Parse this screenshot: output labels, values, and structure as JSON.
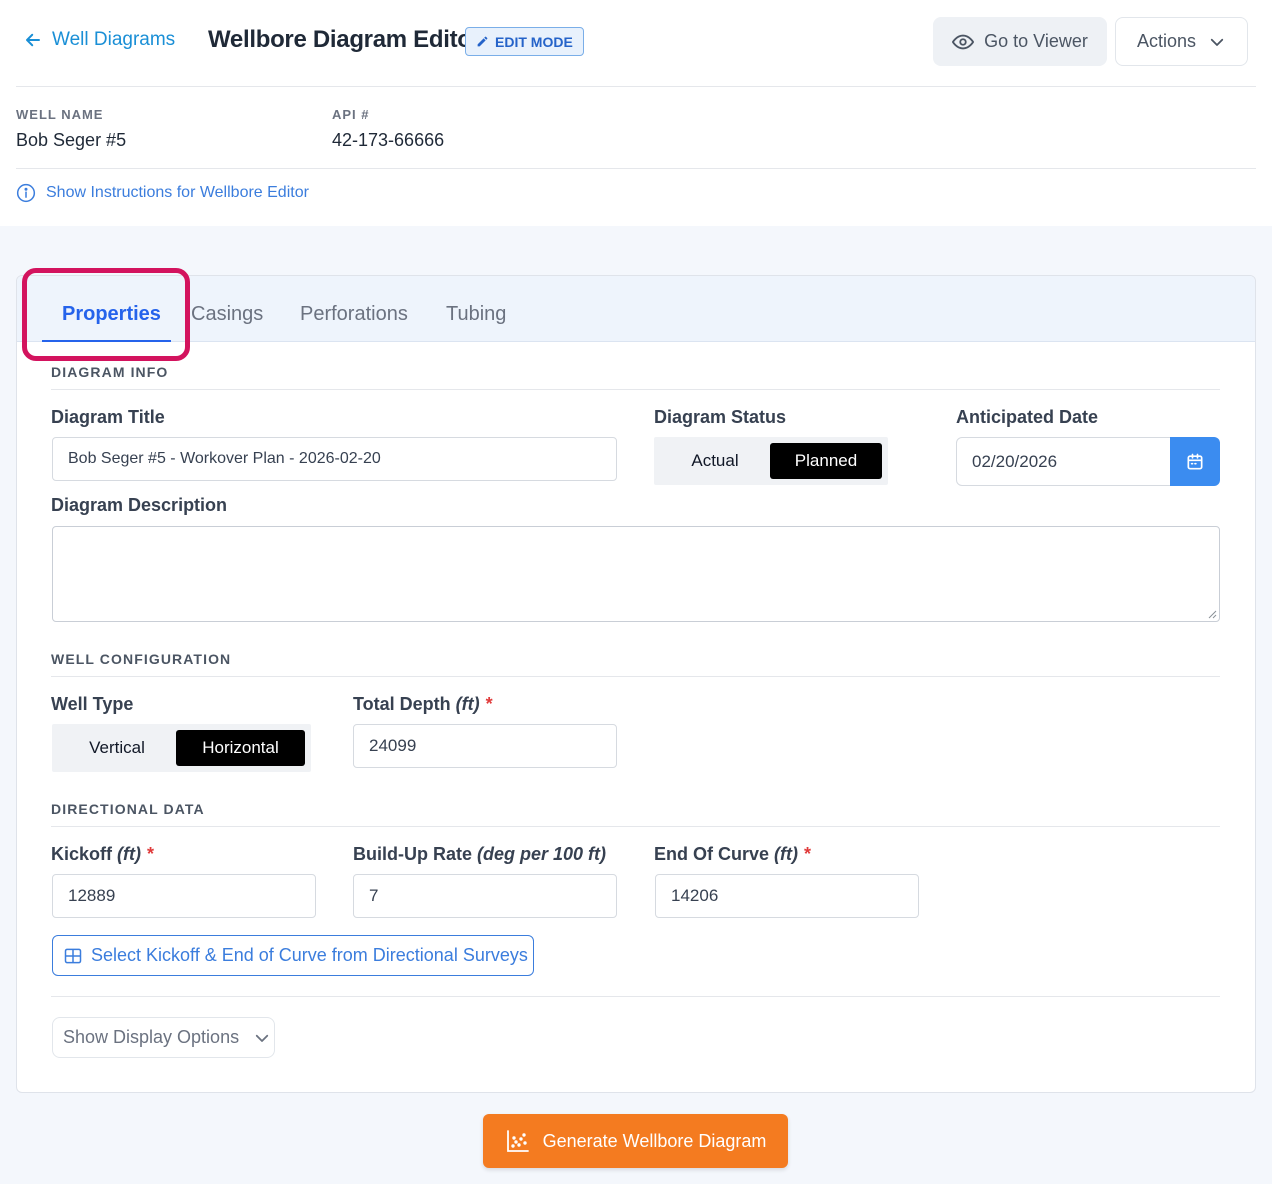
{
  "header": {
    "back_label": "Well Diagrams",
    "title": "Wellbore Diagram Editor",
    "badge": "EDIT MODE",
    "viewer_button": "Go to Viewer",
    "actions_button": "Actions"
  },
  "well": {
    "name_label": "WELL NAME",
    "name_value": "Bob Seger #5",
    "api_label": "API #",
    "api_value": "42-173-66666"
  },
  "instructions_link": "Show Instructions for Wellbore Editor",
  "tabs": [
    {
      "label": "Properties",
      "active": true
    },
    {
      "label": "Casings",
      "active": false
    },
    {
      "label": "Perforations",
      "active": false
    },
    {
      "label": "Tubing",
      "active": false
    }
  ],
  "diagram_info": {
    "section": "DIAGRAM INFO",
    "title_label": "Diagram Title",
    "title_value": "Bob Seger #5 - Workover Plan - 2026-02-20",
    "status_label": "Diagram Status",
    "status_options": [
      "Actual",
      "Planned"
    ],
    "status_selected": "Planned",
    "date_label": "Anticipated Date",
    "date_value": "02/20/2026",
    "description_label": "Diagram Description",
    "description_value": ""
  },
  "well_config": {
    "section": "WELL CONFIGURATION",
    "type_label": "Well Type",
    "type_options": [
      "Vertical",
      "Horizontal"
    ],
    "type_selected": "Horizontal",
    "depth_label": "Total Depth",
    "depth_unit": "(ft)",
    "depth_value": "24099"
  },
  "directional": {
    "section": "DIRECTIONAL DATA",
    "kickoff_label": "Kickoff",
    "kickoff_unit": "(ft)",
    "kickoff_value": "12889",
    "buildup_label": "Build-Up Rate",
    "buildup_unit": "(deg per 100 ft)",
    "buildup_value": "7",
    "eoc_label": "End Of Curve",
    "eoc_unit": "(ft)",
    "eoc_value": "14206",
    "select_button": "Select Kickoff & End of Curve from Directional Surveys"
  },
  "display_options_button": "Show Display Options",
  "generate_button": "Generate Wellbore Diagram",
  "required_mark": "*",
  "colors": {
    "primary": "#2563eb",
    "link": "#1a8fd6",
    "generate": "#f47b20",
    "highlight": "#d3135e",
    "required": "#e03a3a"
  }
}
